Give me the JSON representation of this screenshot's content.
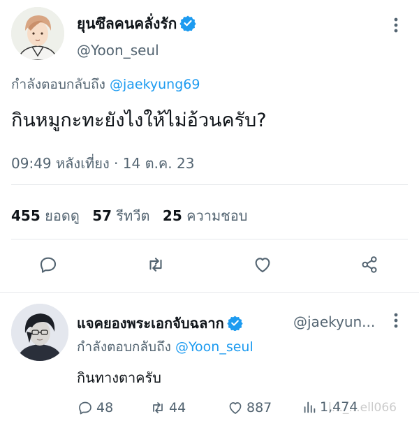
{
  "main_tweet": {
    "display_name": "ยุนซึลคนคลั่งรัก",
    "handle": "@Yoon_seul",
    "replying_prefix": "กำลังตอบกลับถึง",
    "replying_to": "@jaekyung69",
    "text": "กินหมูกะทะยังไงให้ไม่อ้วนครับ?",
    "timestamp": "09:49 หลังเที่ยง · 14 ต.ค. 23",
    "stats": {
      "views_count": "455",
      "views_label": "ยอดดู",
      "retweets_count": "57",
      "retweets_label": "รีทวีต",
      "likes_count": "25",
      "likes_label": "ความชอบ"
    }
  },
  "reply_tweet": {
    "display_name": "แจคยองพระเอกจับฉลาก",
    "handle": "@jaekyun...",
    "replying_prefix": "กำลังตอบกลับถึง",
    "replying_to": "@Yoon_seul",
    "text": "กินทางตาครับ",
    "actions": {
      "replies": "48",
      "retweets": "44",
      "likes": "887",
      "views": "1,474"
    }
  },
  "watermark": "l..._...ell066",
  "colors": {
    "verified": "#1d9bf0",
    "mention": "#1d9bf0",
    "secondary_text": "#536471",
    "primary_text": "#0f1419"
  },
  "icons": [
    "verified-badge-icon",
    "more-options-icon",
    "reply-icon",
    "retweet-icon",
    "like-icon",
    "share-icon",
    "views-icon"
  ]
}
